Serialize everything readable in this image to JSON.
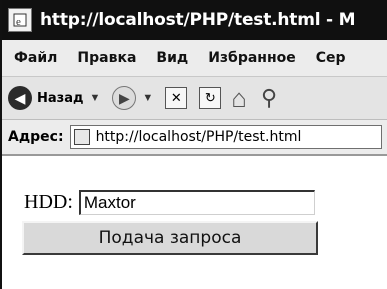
{
  "window": {
    "title": "http://localhost/PHP/test.html - M"
  },
  "menu": {
    "items": [
      "Файл",
      "Правка",
      "Вид",
      "Избранное",
      "Сер"
    ]
  },
  "toolbar": {
    "back_label": "Назад",
    "icons": [
      "back-icon",
      "forward-icon",
      "stop-icon",
      "refresh-icon",
      "home-icon",
      "search-icon"
    ]
  },
  "address": {
    "label": "Адрес:",
    "url": "http://localhost/PHP/test.html"
  },
  "form": {
    "hdd_label": "HDD:",
    "hdd_value": "Maxtor",
    "submit_label": "Подача запроса"
  }
}
